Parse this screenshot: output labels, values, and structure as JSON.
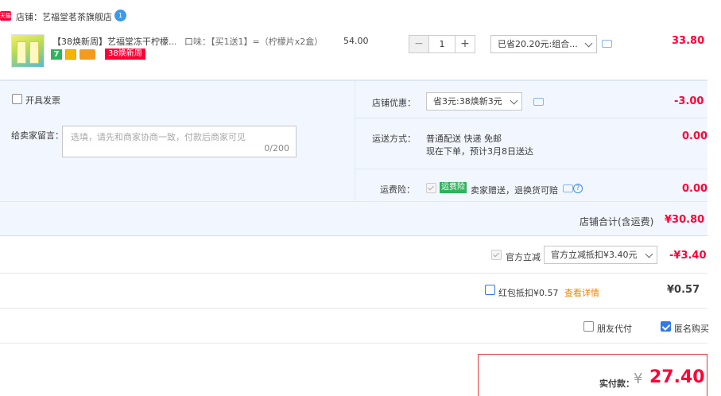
{
  "shop": {
    "badge": "天猫",
    "name": "店铺：艺福堂茗茶旗舰店",
    "chat_badge": "1"
  },
  "item": {
    "title": "【38焕新周】艺福堂冻干柠檬...",
    "icon_seven": "7",
    "promo_tag": "38焕新周",
    "sku": "口味：【买1送1】=（柠檬片x2盒）",
    "unit_price": "54.00",
    "quantity": "1",
    "qty_minus": "−",
    "qty_plus": "+",
    "promo_select": "已省20.20元:组合...",
    "total": "33.80"
  },
  "panel": {
    "invoice_label": "开具发票",
    "message_label": "给卖家留言：",
    "message_placeholder": "选填，请先和商家协商一致，付款后商家可见",
    "message_count": "0/200",
    "shop_discount_label": "店铺优惠：",
    "shop_discount_select": "省3元:38焕新3元",
    "shop_discount_value": "-3.00",
    "shipping_label": "运送方式：",
    "shipping_method": "普通配送 快递 免邮",
    "shipping_eta": "现在下单，预计3月8日送达",
    "shipping_value": "0.00",
    "insurance_label": "运费险：",
    "insurance_tag": "运费险",
    "insurance_desc": "卖家赠送，退换货可赔",
    "insurance_help": "?",
    "insurance_value": "0.00",
    "shop_total_label": "店铺合计(含运费)",
    "shop_total_value": "¥30.80"
  },
  "official": {
    "label": "官方立减",
    "select": "官方立减抵扣¥3.40元",
    "value": "-¥3.40"
  },
  "redpacket": {
    "label": "红包抵扣¥0.57",
    "link": "查看详情",
    "value": "¥0.57"
  },
  "options": {
    "friend_pay": "朋友代付",
    "anonymous": "匿名购买"
  },
  "payment": {
    "label": "实付款：",
    "currency": "¥",
    "amount": "27.40"
  }
}
